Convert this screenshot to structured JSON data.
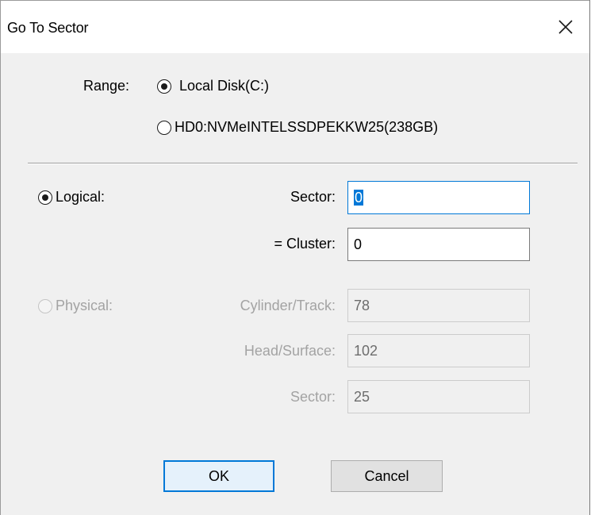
{
  "window": {
    "title": "Go To Sector"
  },
  "range": {
    "label": "Range:",
    "options": [
      {
        "label": "Local Disk(C:)",
        "checked": true
      },
      {
        "label": "HD0:NVMeINTELSSDPEKKW25(238GB)",
        "checked": false
      }
    ]
  },
  "logical": {
    "label": "Logical:",
    "checked": true,
    "sector_label": "Sector:",
    "sector_value": "0",
    "cluster_label": "= Cluster:",
    "cluster_value": "0"
  },
  "physical": {
    "label": "Physical:",
    "checked": false,
    "enabled": false,
    "cylinder_label": "Cylinder/Track:",
    "cylinder_value": "78",
    "head_label": "Head/Surface:",
    "head_value": "102",
    "sector_label": "Sector:",
    "sector_value": "25"
  },
  "buttons": {
    "ok": "OK",
    "cancel": "Cancel"
  },
  "colors": {
    "accent": "#0078d7",
    "disabled_text": "#a3a3a3",
    "dialog_bg": "#f0f0f0"
  }
}
